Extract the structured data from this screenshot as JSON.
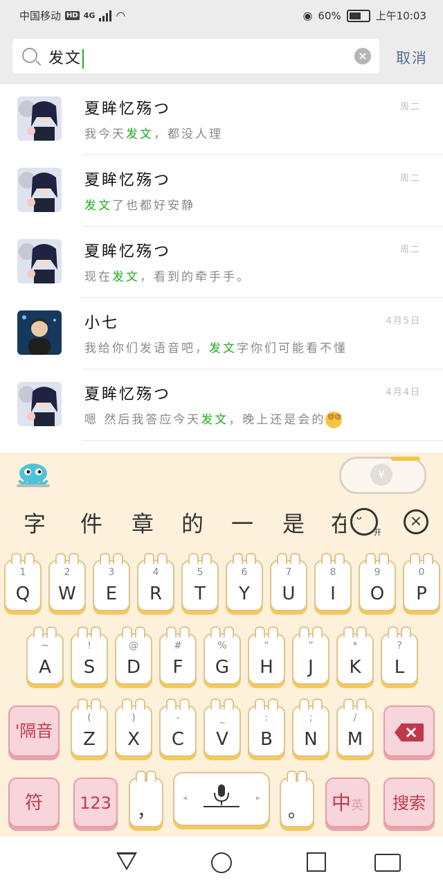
{
  "status_bar": {
    "carrier": "中国移动",
    "network_badge": "HD",
    "signal_label": "4G",
    "battery": "60%",
    "time": "上午10:03"
  },
  "search": {
    "query": "发文",
    "cancel_label": "取消"
  },
  "results": [
    {
      "name": "夏眸忆殇つ",
      "time": "周二",
      "pre": "我今天",
      "hl": "发文",
      "post": "，都没人理"
    },
    {
      "name": "夏眸忆殇つ",
      "time": "周二",
      "pre": "",
      "hl": "发文",
      "post": "了也都好安静"
    },
    {
      "name": "夏眸忆殇つ",
      "time": "周二",
      "pre": "现在",
      "hl": "发文",
      "post": "，看到的牵手手。"
    },
    {
      "name": "小七",
      "time": "4月5日",
      "pre": "我给你们发语音吧，",
      "hl": "发文",
      "post": "字你们可能看不懂"
    },
    {
      "name": "夏眸忆殇つ",
      "time": "4月4日",
      "pre": "嗯 然后我答应今天",
      "hl": "发文",
      "post": "，晚上还是会的"
    }
  ],
  "keyboard": {
    "candidates": [
      "字",
      "件",
      "章",
      "的",
      "一",
      "是",
      "在"
    ],
    "emoji_switch_label": "开",
    "row1": [
      {
        "ch": "Q",
        "sub": "1"
      },
      {
        "ch": "W",
        "sub": "2"
      },
      {
        "ch": "E",
        "sub": "3"
      },
      {
        "ch": "R",
        "sub": "4"
      },
      {
        "ch": "T",
        "sub": "5"
      },
      {
        "ch": "Y",
        "sub": "6"
      },
      {
        "ch": "U",
        "sub": "7"
      },
      {
        "ch": "I",
        "sub": "8"
      },
      {
        "ch": "O",
        "sub": "9"
      },
      {
        "ch": "P",
        "sub": "0"
      }
    ],
    "row2": [
      {
        "ch": "A",
        "sub": "~"
      },
      {
        "ch": "S",
        "sub": "!"
      },
      {
        "ch": "D",
        "sub": "@"
      },
      {
        "ch": "F",
        "sub": "#"
      },
      {
        "ch": "G",
        "sub": "%"
      },
      {
        "ch": "H",
        "sub": "“"
      },
      {
        "ch": "J",
        "sub": "”"
      },
      {
        "ch": "K",
        "sub": "*"
      },
      {
        "ch": "L",
        "sub": "?"
      }
    ],
    "row3": [
      {
        "ch": "Z",
        "sub": "("
      },
      {
        "ch": "X",
        "sub": ")"
      },
      {
        "ch": "C",
        "sub": "-"
      },
      {
        "ch": "V",
        "sub": "_"
      },
      {
        "ch": "B",
        "sub": ":"
      },
      {
        "ch": "N",
        "sub": ";"
      },
      {
        "ch": "M",
        "sub": "/"
      }
    ],
    "separator_label": "'隔音",
    "symbol_label": "符",
    "number_label": "123",
    "comma_label": "，",
    "period_label": "。",
    "lang_main": "中",
    "lang_alt": "英",
    "search_label": "搜索"
  },
  "colors": {
    "highlight": "#1aad19",
    "cancel": "#576b95",
    "keyboard_bg": "#fdf1db"
  }
}
